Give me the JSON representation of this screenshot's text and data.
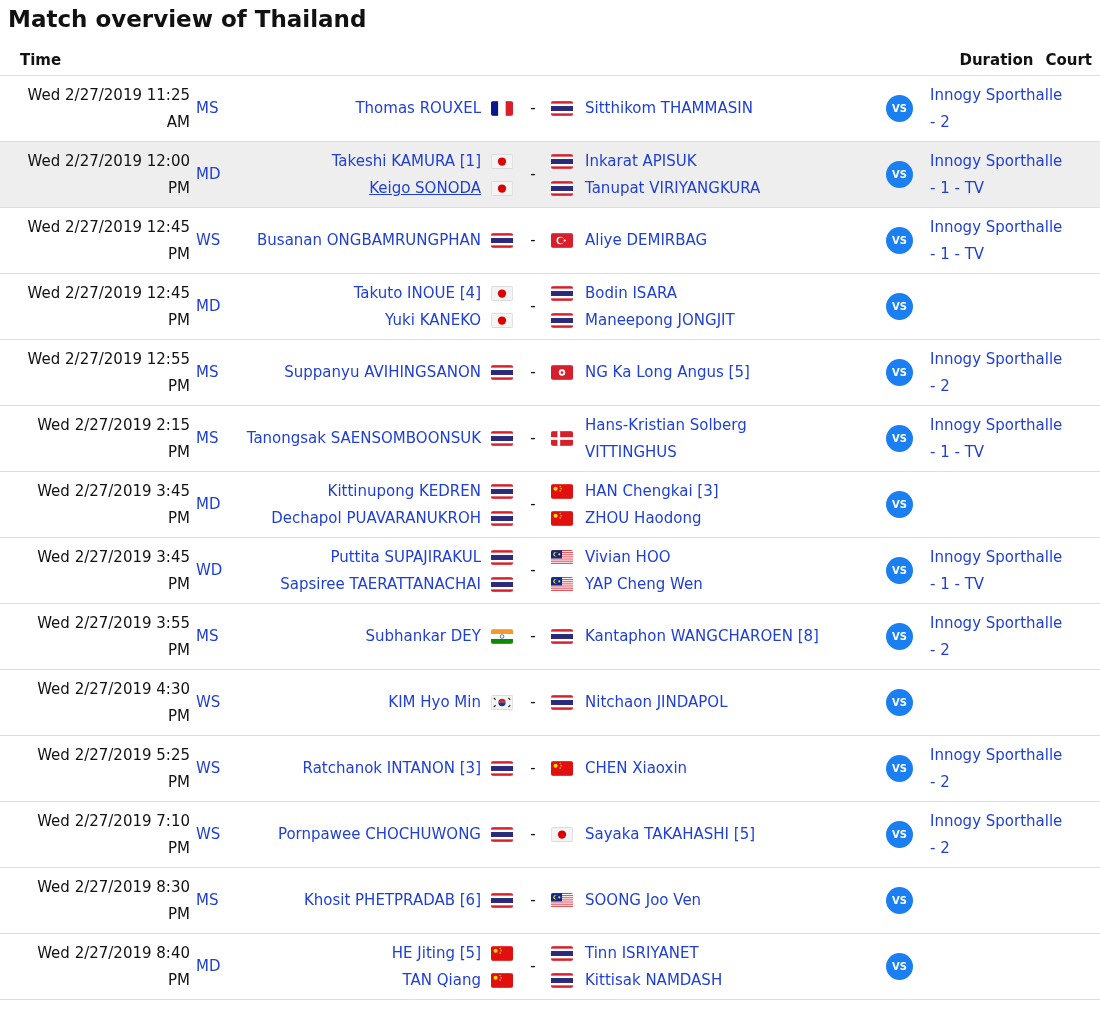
{
  "title": "Match overview of Thailand",
  "header": {
    "time": "Time",
    "duration": "Duration",
    "court": "Court"
  },
  "matches": [
    {
      "time": "Wed 2/27/2019 11:25 AM",
      "event": "MS",
      "selected": false,
      "team1": [
        {
          "name": "Thomas ROUXEL",
          "kind": "fr",
          "hovered": false
        }
      ],
      "team2": [
        {
          "name": "Sitthikom THAMMASIN",
          "kind": "th",
          "hovered": false
        }
      ],
      "sep": "-",
      "vs": "VS",
      "court": "Innogy Sporthalle - 2"
    },
    {
      "time": "Wed 2/27/2019 12:00 PM",
      "event": "MD",
      "selected": true,
      "team1": [
        {
          "name": "Takeshi KAMURA [1]",
          "kind": "jp",
          "hovered": false
        },
        {
          "name": "Keigo SONODA",
          "kind": "jp",
          "hovered": true
        }
      ],
      "team2": [
        {
          "name": "Inkarat APISUK",
          "kind": "th",
          "hovered": false
        },
        {
          "name": "Tanupat VIRIYANGKURA",
          "kind": "th",
          "hovered": false
        }
      ],
      "sep": "-",
      "vs": "VS",
      "court": "Innogy Sporthalle - 1 - TV"
    },
    {
      "time": "Wed 2/27/2019 12:45 PM",
      "event": "WS",
      "selected": false,
      "team1": [
        {
          "name": "Busanan ONGBAMRUNGPHAN",
          "kind": "th",
          "hovered": false
        }
      ],
      "team2": [
        {
          "name": "Aliye DEMIRBAG",
          "kind": "tr",
          "hovered": false
        }
      ],
      "sep": "-",
      "vs": "VS",
      "court": "Innogy Sporthalle - 1 - TV"
    },
    {
      "time": "Wed 2/27/2019 12:45 PM",
      "event": "MD",
      "selected": false,
      "team1": [
        {
          "name": "Takuto INOUE [4]",
          "kind": "jp",
          "hovered": false
        },
        {
          "name": "Yuki KANEKO",
          "kind": "jp",
          "hovered": false
        }
      ],
      "team2": [
        {
          "name": "Bodin ISARA",
          "kind": "th",
          "hovered": false
        },
        {
          "name": "Maneepong JONGJIT",
          "kind": "th",
          "hovered": false
        }
      ],
      "sep": "-",
      "vs": "VS"
    },
    {
      "time": "Wed 2/27/2019 12:55 PM",
      "event": "MS",
      "selected": false,
      "team1": [
        {
          "name": "Suppanyu AVIHINGSANON",
          "kind": "th",
          "hovered": false
        }
      ],
      "team2": [
        {
          "name": "NG Ka Long Angus [5]",
          "kind": "hk",
          "hovered": false
        }
      ],
      "sep": "-",
      "vs": "VS",
      "court": "Innogy Sporthalle - 2"
    },
    {
      "time": "Wed 2/27/2019 2:15 PM",
      "event": "MS",
      "selected": false,
      "team1": [
        {
          "name": "Tanongsak SAENSOMBOONSUK",
          "kind": "th",
          "hovered": false
        }
      ],
      "team2": [
        {
          "name": "Hans-Kristian Solberg VITTINGHUS",
          "kind": "dk",
          "hovered": false
        }
      ],
      "sep": "-",
      "vs": "VS",
      "court": "Innogy Sporthalle - 1 - TV"
    },
    {
      "time": "Wed 2/27/2019 3:45 PM",
      "event": "MD",
      "selected": false,
      "team1": [
        {
          "name": "Kittinupong KEDREN",
          "kind": "th",
          "hovered": false
        },
        {
          "name": "Dechapol PUAVARANUKROH",
          "kind": "th",
          "hovered": false
        }
      ],
      "team2": [
        {
          "name": "HAN Chengkai [3]",
          "kind": "cn",
          "hovered": false
        },
        {
          "name": "ZHOU Haodong",
          "kind": "cn",
          "hovered": false
        }
      ],
      "sep": "-",
      "vs": "VS"
    },
    {
      "time": "Wed 2/27/2019 3:45 PM",
      "event": "WD",
      "selected": false,
      "team1": [
        {
          "name": "Puttita SUPAJIRAKUL",
          "kind": "th",
          "hovered": false
        },
        {
          "name": "Sapsiree TAERATTANACHAI",
          "kind": "th",
          "hovered": false
        }
      ],
      "team2": [
        {
          "name": "Vivian HOO",
          "kind": "my",
          "hovered": false
        },
        {
          "name": "YAP Cheng Wen",
          "kind": "my",
          "hovered": false
        }
      ],
      "sep": "-",
      "vs": "VS",
      "court": "Innogy Sporthalle - 1 - TV"
    },
    {
      "time": "Wed 2/27/2019 3:55 PM",
      "event": "MS",
      "selected": false,
      "team1": [
        {
          "name": "Subhankar DEY",
          "kind": "in",
          "hovered": false
        }
      ],
      "team2": [
        {
          "name": "Kantaphon WANGCHAROEN [8]",
          "kind": "th",
          "hovered": false
        }
      ],
      "sep": "-",
      "vs": "VS",
      "court": "Innogy Sporthalle - 2"
    },
    {
      "time": "Wed 2/27/2019 4:30 PM",
      "event": "WS",
      "selected": false,
      "team1": [
        {
          "name": "KIM Hyo Min",
          "kind": "kr",
          "hovered": false
        }
      ],
      "team2": [
        {
          "name": "Nitchaon JINDAPOL",
          "kind": "th",
          "hovered": false
        }
      ],
      "sep": "-",
      "vs": "VS"
    },
    {
      "time": "Wed 2/27/2019 5:25 PM",
      "event": "WS",
      "selected": false,
      "team1": [
        {
          "name": "Ratchanok INTANON [3]",
          "kind": "th",
          "hovered": false
        }
      ],
      "team2": [
        {
          "name": "CHEN Xiaoxin",
          "kind": "cn",
          "hovered": false
        }
      ],
      "sep": "-",
      "vs": "VS",
      "court": "Innogy Sporthalle - 2"
    },
    {
      "time": "Wed 2/27/2019 7:10 PM",
      "event": "WS",
      "selected": false,
      "team1": [
        {
          "name": "Pornpawee CHOCHUWONG",
          "kind": "th",
          "hovered": false
        }
      ],
      "team2": [
        {
          "name": "Sayaka TAKAHASHI [5]",
          "kind": "jp",
          "hovered": false
        }
      ],
      "sep": "-",
      "vs": "VS",
      "court": "Innogy Sporthalle - 2"
    },
    {
      "time": "Wed 2/27/2019 8:30 PM",
      "event": "MS",
      "selected": false,
      "team1": [
        {
          "name": "Khosit PHETPRADAB [6]",
          "kind": "th",
          "hovered": false
        }
      ],
      "team2": [
        {
          "name": "SOONG Joo Ven",
          "kind": "my",
          "hovered": false
        }
      ],
      "sep": "-",
      "vs": "VS"
    },
    {
      "time": "Wed 2/27/2019 8:40 PM",
      "event": "MD",
      "selected": false,
      "team1": [
        {
          "name": "HE Jiting [5]",
          "kind": "cn",
          "hovered": false
        },
        {
          "name": "TAN Qiang",
          "kind": "cn",
          "hovered": false
        }
      ],
      "team2": [
        {
          "name": "Tinn ISRIYANET",
          "kind": "th",
          "hovered": false
        },
        {
          "name": "Kittisak NAMDASH",
          "kind": "th",
          "hovered": false
        }
      ],
      "sep": "-",
      "vs": "VS"
    }
  ]
}
